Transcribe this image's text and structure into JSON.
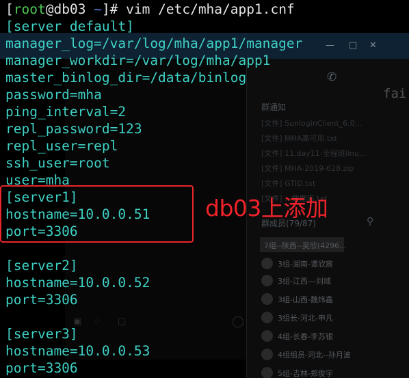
{
  "terminal": {
    "prompt": {
      "open_bracket": "[",
      "user": "root",
      "at": "@",
      "host": "db03",
      "space": " ",
      "cwd": "~",
      "close_bracket": "]#",
      "command": " vim /etc/mha/app1.cnf"
    },
    "lines": [
      "[server default]",
      "manager_log=/var/log/mha/app1/manager",
      "manager_workdir=/var/log/mha/app1",
      "master_binlog_dir=/data/binlog",
      "password=mha",
      "ping_interval=2",
      "repl_password=123",
      "repl_user=repl",
      "ssh_user=root",
      "user=mha",
      "[server1]",
      "hostname=10.0.0.51",
      "port=3306",
      "",
      "[server2]",
      "hostname=10.0.0.52",
      "port=3306",
      "",
      "[server3]",
      "hostname=10.0.0.53",
      "port=3306"
    ]
  },
  "annotation": {
    "text": "db03上添加",
    "color": "#f0232a"
  },
  "background_window": {
    "minimize": "—",
    "maximize": "□",
    "close": "✕",
    "side_text": "fai",
    "notice_title": "群通知",
    "files": [
      "[文件] SunloginClient_6.0...",
      "[文件] MHA高可用.txt",
      "[文件] 11.day11-全程班linu...",
      "[文件] MHA-2019-628.zip",
      "[文件] GTID.txt",
      "[文件] ...数据库.txt"
    ],
    "members_header": "群成员(79/87)",
    "members": [
      "7组--陕西--吴欣(4296...",
      "3组-湖南-谭欣宸",
      "3组-江西---刘域",
      "3组-山西-魏炜鑫",
      "3组长-河北-申凡",
      "4组-长春-李苏银",
      "4组组员-河北--孙月波",
      "5组-吉林-郑俊宇"
    ]
  }
}
